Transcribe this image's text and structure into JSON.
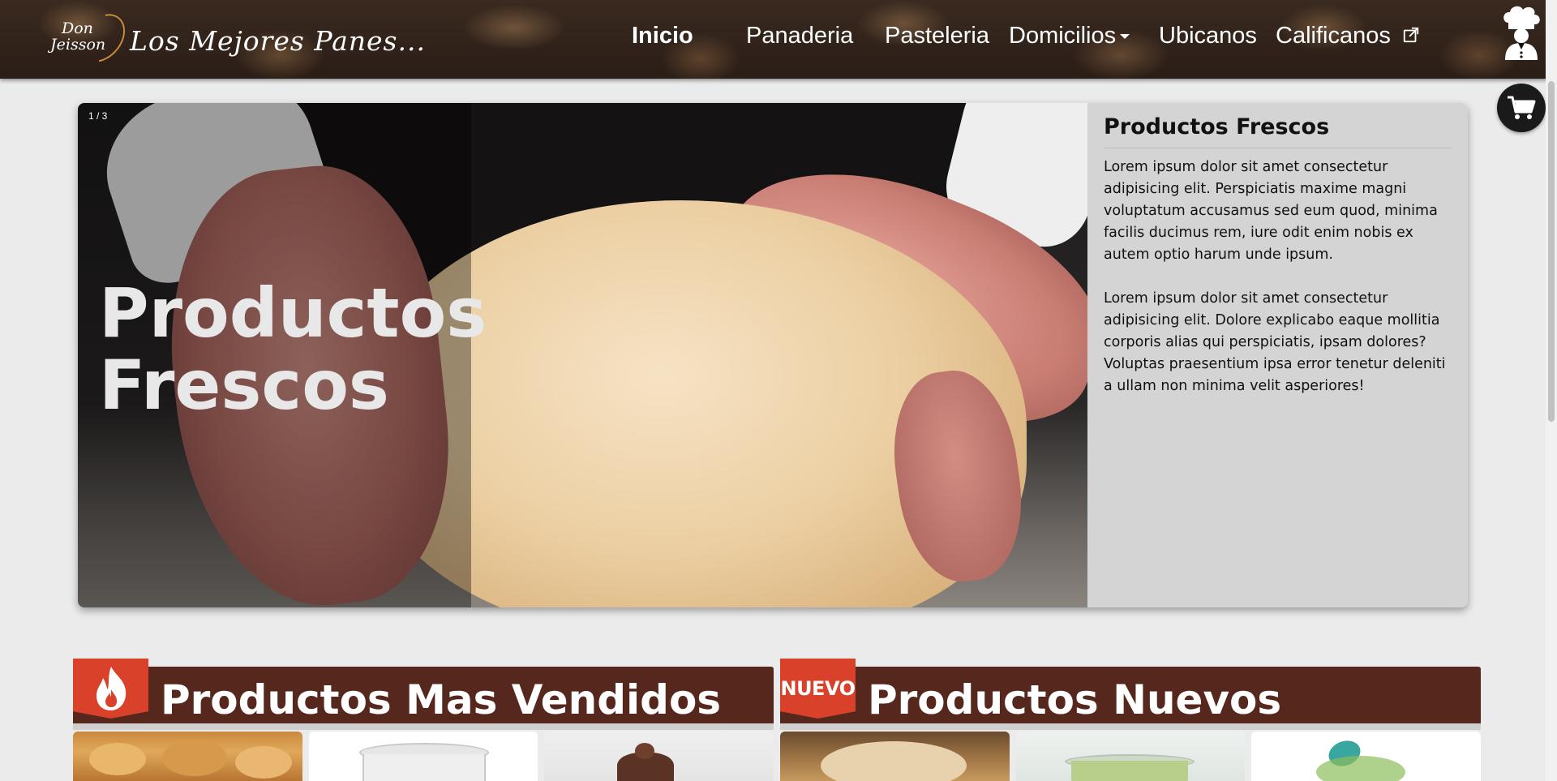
{
  "brand": {
    "logo_line1": "Don",
    "logo_line2": "Jeisson",
    "tagline": "Los Mejores Panes..."
  },
  "nav": {
    "items": [
      {
        "label": "Inicio",
        "active": true
      },
      {
        "label": "Panaderia"
      },
      {
        "label": "Pasteleria"
      },
      {
        "label": "Domicilios",
        "dropdown": true
      },
      {
        "label": "Ubicanos"
      },
      {
        "label": "Calificanos",
        "external": true
      }
    ]
  },
  "icons": {
    "chef": "chef-icon",
    "cart": "cart-icon",
    "external": "external-link-icon",
    "fire": "fire-icon"
  },
  "hero": {
    "counter": "1 / 3",
    "title": "Productos Frescos",
    "aside_title": "Productos Frescos",
    "paragraph_1": "Lorem ipsum dolor sit amet consectetur adipisicing elit. Perspiciatis maxime magni voluptatum accusamus sed eum quod, minima facilis ducimus rem, iure odit enim nobis ex autem optio harum unde ipsum.",
    "paragraph_2": "Lorem ipsum dolor sit amet consectetur adipisicing elit. Dolore explicabo eaque mollitia corporis alias qui perspiciatis, ipsam dolores? Voluptas praesentium ipsa error tenetur deleniti a ullam non minima velit asperiores!"
  },
  "sections": {
    "best_sellers": {
      "title": "Productos Mas Vendidos"
    },
    "new_products": {
      "title": "Productos Nuevos",
      "badge": "NUEVO"
    }
  },
  "colors": {
    "section_header": "#56281d",
    "badge": "#d9412a",
    "aside_bg": "#d4d4d4",
    "page_bg": "#ebebeb"
  }
}
